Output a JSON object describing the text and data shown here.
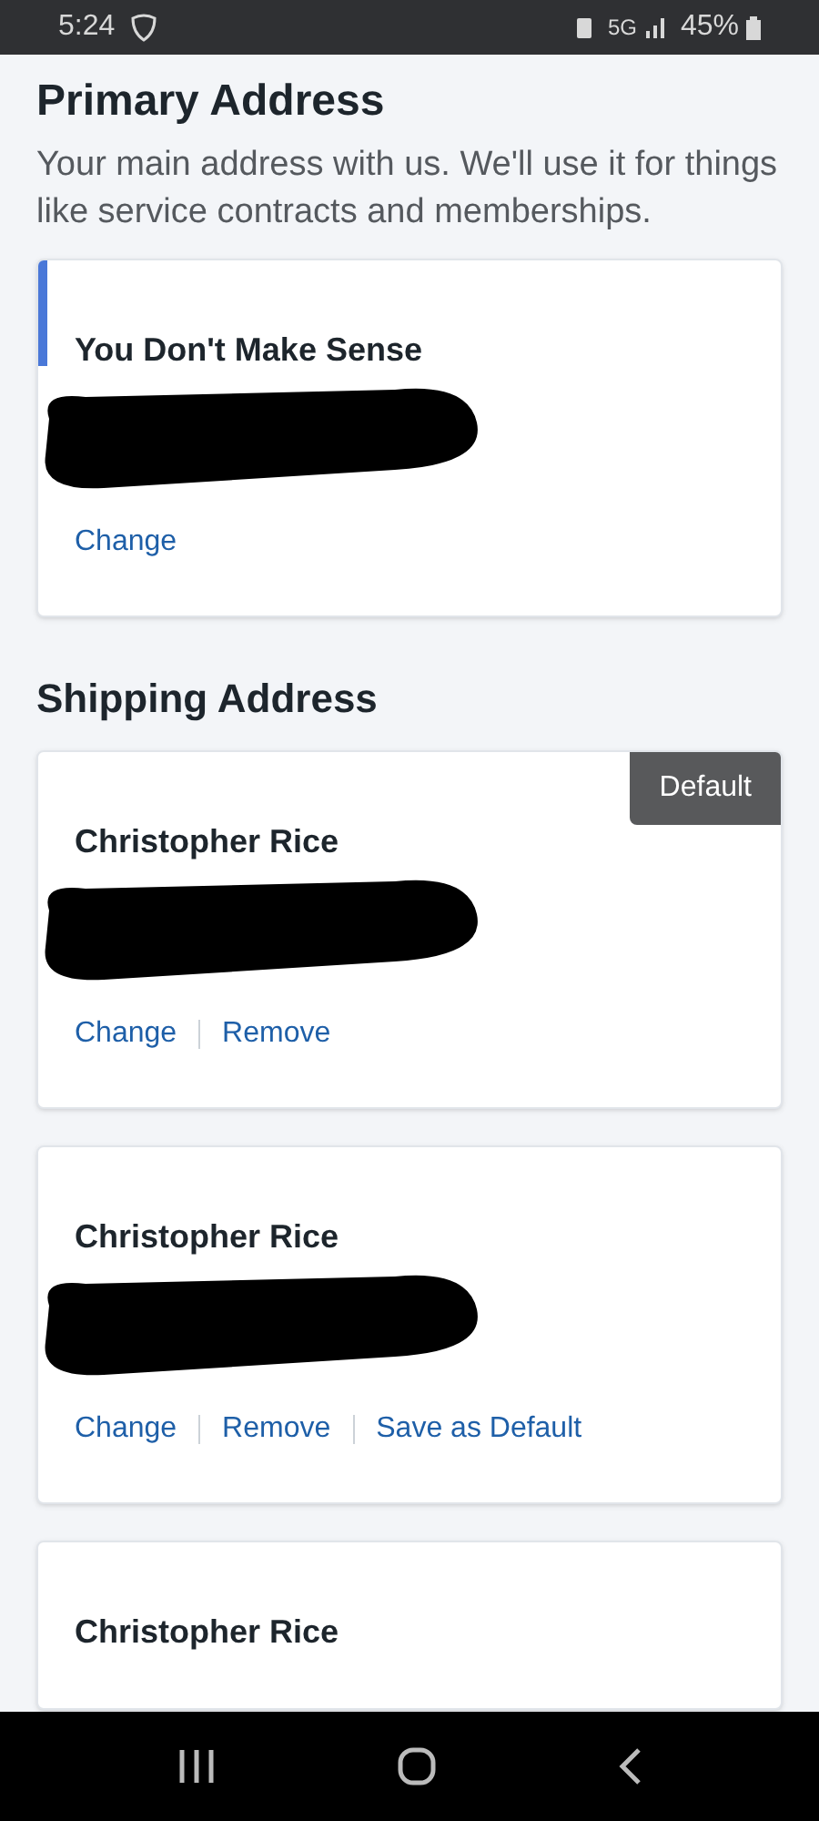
{
  "status_bar": {
    "time": "5:24",
    "network": "5G",
    "battery": "45%"
  },
  "primary_address": {
    "title": "Primary Address",
    "description": "Your main address with us. We'll use it for things like service contracts and memberships.",
    "card": {
      "name": "You Don't Make Sense",
      "accent": true,
      "redacted": true,
      "links": [
        "Change"
      ]
    }
  },
  "shipping_address": {
    "title": "Shipping Address",
    "cards": [
      {
        "name": "Christopher Rice",
        "badge": "Default",
        "redacted": true,
        "links": [
          "Change",
          "Remove"
        ]
      },
      {
        "name": "Christopher Rice",
        "redacted": true,
        "links": [
          "Change",
          "Remove",
          "Save as Default"
        ]
      },
      {
        "name": "Christopher Rice",
        "redacted": false
      }
    ]
  }
}
